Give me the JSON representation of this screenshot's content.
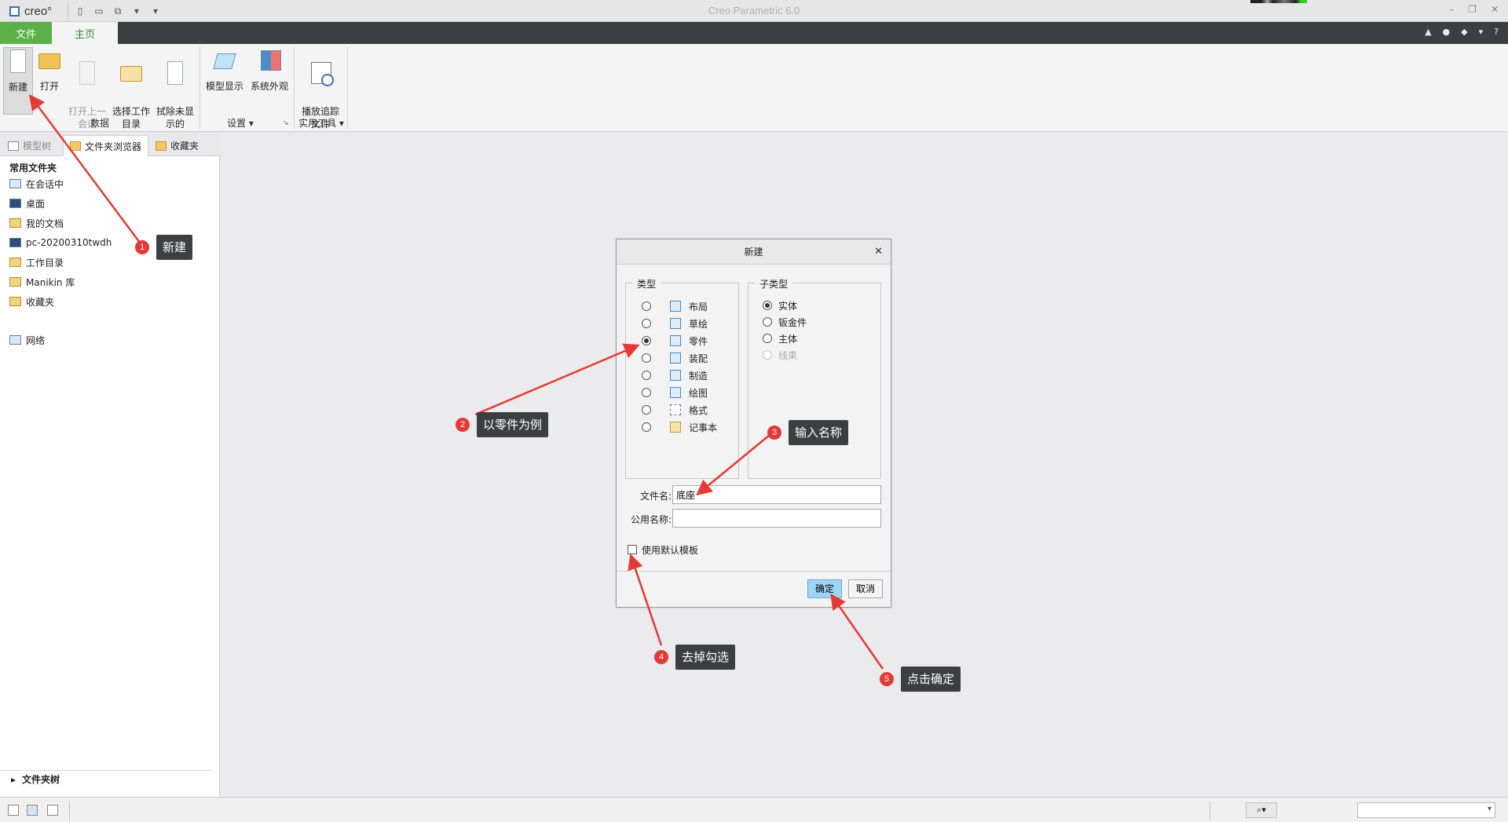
{
  "app": {
    "logo_text": "creo°",
    "window_title": "Creo Parametric 6.0"
  },
  "tabs": {
    "file": "文件",
    "home": "主页"
  },
  "ribbon": {
    "buttons": [
      {
        "label": "新建",
        "icon": "new-document-icon"
      },
      {
        "label": "打开",
        "icon": "open-folder-icon"
      },
      {
        "label": "打开上一\n会话",
        "icon": "open-last-session-icon"
      },
      {
        "label": "选择工作\n目录",
        "icon": "select-working-dir-icon"
      },
      {
        "label": "拭除未显\n示的",
        "icon": "erase-not-displayed-icon"
      },
      {
        "label": "模型显示",
        "icon": "model-display-icon"
      },
      {
        "label": "系统外观",
        "icon": "system-appearance-icon"
      },
      {
        "label": "播放追踪\n文件",
        "icon": "play-trail-file-icon"
      }
    ],
    "groups": {
      "data": "数据",
      "settings": "设置",
      "utilities": "实用工具"
    }
  },
  "navigator": {
    "tabs": [
      "模型树",
      "文件夹浏览器",
      "收藏夹"
    ],
    "common_folders_title": "常用文件夹",
    "folders": [
      "在会话中",
      "桌面",
      "我的文档",
      "pc-20200310twdh",
      "工作目录",
      "Manikin 库",
      "收藏夹"
    ],
    "network": "网络",
    "folder_tree": "文件夹树"
  },
  "dialog": {
    "title": "新建",
    "type_label": "类型",
    "types": [
      "布局",
      "草绘",
      "零件",
      "装配",
      "制造",
      "绘图",
      "格式",
      "记事本"
    ],
    "selected_type": "零件",
    "subtype_label": "子类型",
    "subtypes": [
      "实体",
      "钣金件",
      "主体",
      "线束"
    ],
    "selected_subtype": "实体",
    "filename_label": "文件名:",
    "filename_value": "底座",
    "common_name_label": "公用名称:",
    "common_name_value": "",
    "use_default_template": "使用默认模板",
    "ok": "确定",
    "cancel": "取消"
  },
  "annotations": [
    {
      "num": "1",
      "text": "新建"
    },
    {
      "num": "2",
      "text": "以零件为例"
    },
    {
      "num": "3",
      "text": "输入名称"
    },
    {
      "num": "4",
      "text": "去掉勾选"
    },
    {
      "num": "5",
      "text": "点击确定"
    }
  ],
  "colors": {
    "file_tab": "#5bb04a",
    "tab_bar": "#3b3f44",
    "ok_button": "#9fd6f6",
    "annotation_red": "#e53935",
    "callout_bg": "#3c3f41"
  }
}
